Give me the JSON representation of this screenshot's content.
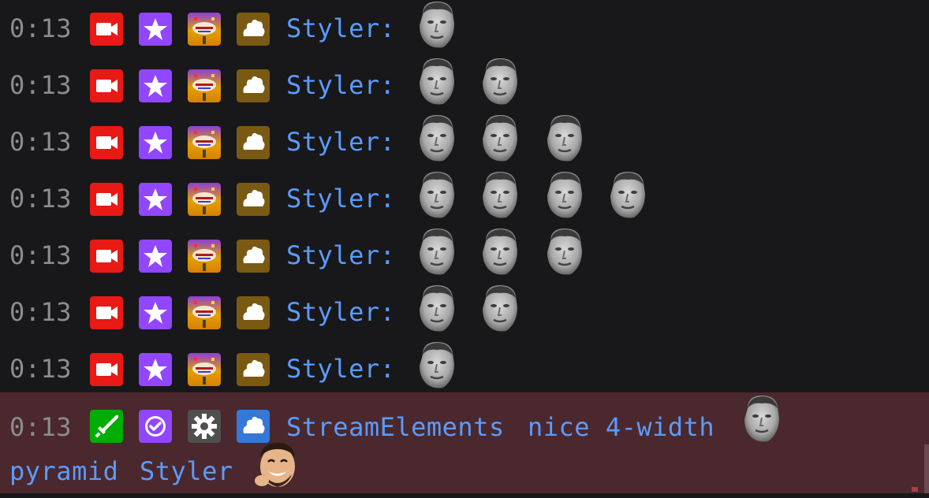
{
  "messages": [
    {
      "time": "0:13",
      "user": "Styler:",
      "emote_count": 1,
      "emote_name": "KappaHD"
    },
    {
      "time": "0:13",
      "user": "Styler:",
      "emote_count": 2,
      "emote_name": "KappaHD"
    },
    {
      "time": "0:13",
      "user": "Styler:",
      "emote_count": 3,
      "emote_name": "KappaHD"
    },
    {
      "time": "0:13",
      "user": "Styler:",
      "emote_count": 4,
      "emote_name": "KappaHD"
    },
    {
      "time": "0:13",
      "user": "Styler:",
      "emote_count": 3,
      "emote_name": "KappaHD"
    },
    {
      "time": "0:13",
      "user": "Styler:",
      "emote_count": 2,
      "emote_name": "KappaHD"
    },
    {
      "time": "0:13",
      "user": "Styler:",
      "emote_count": 1,
      "emote_name": "KappaHD"
    }
  ],
  "highlight": {
    "time": "0:13",
    "user": "StreamElements",
    "text_line1": "nice 4-width",
    "text_line2_a": "pyramid",
    "text_line2_b": "Styler",
    "bg_color": "#4a282d"
  },
  "badges_user": [
    "broadcaster-camera-icon",
    "prime-star-icon",
    "subscriber-badge-icon",
    "cheer-cloud-icon"
  ],
  "badges_bot": [
    "moderator-sword-icon",
    "verified-check-icon",
    "settings-gear-icon",
    "cheer-cloud-blue-icon"
  ],
  "colors": {
    "timestamp": "#8c8c8c",
    "username": "#5b9bff",
    "background": "#18181a"
  }
}
